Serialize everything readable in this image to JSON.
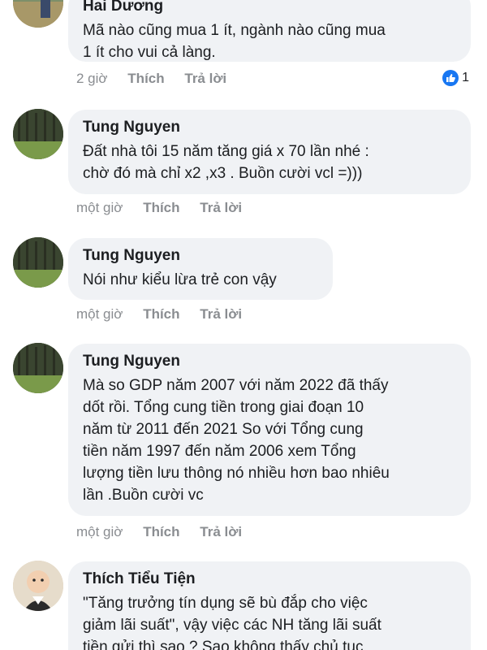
{
  "comments": [
    {
      "author": "Hai Dương",
      "text": "Mã nào cũng mua 1 ít, ngành nào cũng mua\n1 ít cho vui cả làng.",
      "time": "2 giờ",
      "like_label": "Thích",
      "reply_label": "Trả lời",
      "reaction_count": "1"
    },
    {
      "author": "Tung Nguyen",
      "text": "Đất nhà tôi 15 năm tăng giá x 70 lần nhé :\nchờ đó mà chỉ x2 ,x3 . Buồn cười vcl =)))",
      "time": "một giờ",
      "like_label": "Thích",
      "reply_label": "Trả lời"
    },
    {
      "author": "Tung Nguyen",
      "text": "Nói như kiểu lừa trẻ con vậy",
      "time": "một giờ",
      "like_label": "Thích",
      "reply_label": "Trả lời"
    },
    {
      "author": "Tung Nguyen",
      "text": "Mà so GDP năm 2007 với năm 2022 đã thấy\ndốt rồi. Tổng cung tiền trong giai đoạn 10\nnăm từ 2011 đến 2021 So với Tổng cung\ntiền năm 1997 đến năm 2006 xem Tổng\nlượng tiền lưu thông nó nhiều hơn bao nhiêu\nlần .Buồn cười vc",
      "time": "một giờ",
      "like_label": "Thích",
      "reply_label": "Trả lời"
    },
    {
      "author": "Thích Tiểu Tiện",
      "text": "\"Tăng trưởng tín dụng sẽ bù đắp cho việc\ngiảm lãi suất\", vậy việc các NH tăng lãi suất\ntiền gửi thì sao ? Sao không thấy chủ tục"
    }
  ],
  "colors": {
    "bubble": "#f0f2f5",
    "meta_text": "#8a8d91",
    "like_blue": "#1877f2"
  }
}
